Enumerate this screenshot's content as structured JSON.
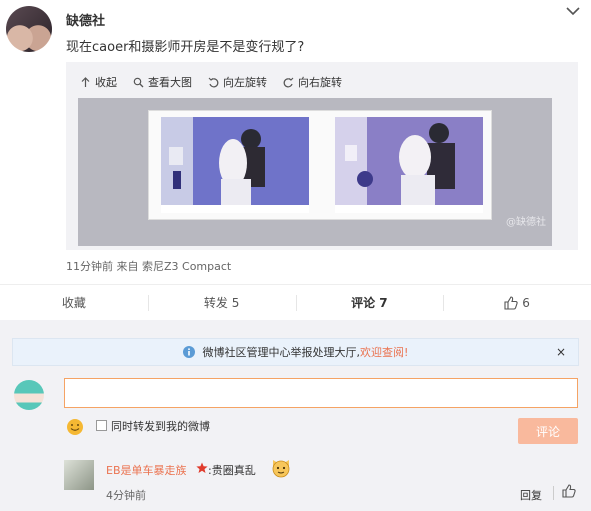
{
  "post": {
    "username": "缺德社",
    "text": "现在caoer和摄影师开房是不是变行规了?",
    "media_toolbar": [
      {
        "label": "收起",
        "icon": "collapse-icon"
      },
      {
        "label": "查看大图",
        "icon": "magnifier-icon"
      },
      {
        "label": "向左旋转",
        "icon": "rotate-left-icon"
      },
      {
        "label": "向右旋转",
        "icon": "rotate-right-icon"
      }
    ],
    "watermark": "@缺德社",
    "meta": "11分钟前  来自 索尼Z3 Compact"
  },
  "actions": {
    "favorite": "收藏",
    "repost": "转发 5",
    "comment": "评论 7",
    "like": "6"
  },
  "notice": {
    "text": "微博社区管理中心举报处理大厅,",
    "link": "欢迎查阅!",
    "close": "×"
  },
  "composer": {
    "input_value": "",
    "checkbox_label": "同时转发到我的微博",
    "submit": "评论"
  },
  "reply": {
    "name": "EB是单车暴走族",
    "text": ":贵圈真乱",
    "time": "4分钟前",
    "reply_label": "回复"
  },
  "colors": {
    "accent": "#eb7350",
    "input_border": "#f5a364",
    "submit_bg": "#f9b99d",
    "notice_bg": "#eaf2fb"
  }
}
